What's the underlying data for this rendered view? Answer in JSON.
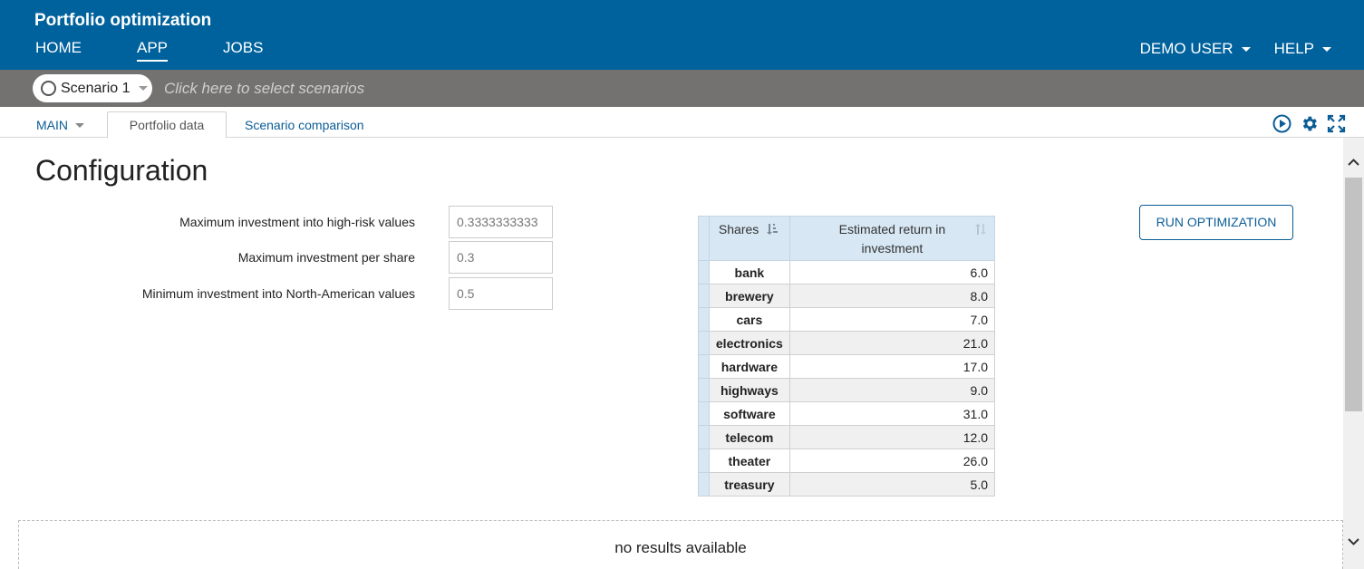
{
  "header": {
    "app_title": "Portfolio optimization",
    "nav": [
      {
        "label": "HOME",
        "active": false
      },
      {
        "label": "APP",
        "active": true
      },
      {
        "label": "JOBS",
        "active": false
      }
    ],
    "user_menu": "DEMO USER",
    "help_menu": "HELP"
  },
  "scenario_bar": {
    "scenario_name": "Scenario 1",
    "placeholder": "Click here to select scenarios"
  },
  "tabs": {
    "main_menu": "MAIN",
    "portfolio": "Portfolio data",
    "comparison": "Scenario comparison",
    "icons": [
      "play-icon",
      "gear-icon",
      "expand-icon"
    ]
  },
  "page": {
    "title": "Configuration",
    "params": [
      {
        "label": "Maximum investment into high-risk values",
        "value": "0.3333333333"
      },
      {
        "label": "Maximum investment per share",
        "value": "0.3"
      },
      {
        "label": "Minimum investment into North-American values",
        "value": "0.5"
      }
    ],
    "run_button": "RUN OPTIMIZATION",
    "table": {
      "col_shares": "Shares",
      "col_return": "Estimated return in investment",
      "rows": [
        {
          "share": "bank",
          "ret": "6.0"
        },
        {
          "share": "brewery",
          "ret": "8.0"
        },
        {
          "share": "cars",
          "ret": "7.0"
        },
        {
          "share": "electronics",
          "ret": "21.0"
        },
        {
          "share": "hardware",
          "ret": "17.0"
        },
        {
          "share": "highways",
          "ret": "9.0"
        },
        {
          "share": "software",
          "ret": "31.0"
        },
        {
          "share": "telecom",
          "ret": "12.0"
        },
        {
          "share": "theater",
          "ret": "26.0"
        },
        {
          "share": "treasury",
          "ret": "5.0"
        }
      ]
    },
    "results_message": "no results available"
  },
  "colors": {
    "header_bg": "#00629d",
    "scenario_bar_bg": "#737270",
    "accent": "#0b5d96",
    "table_header_bg": "#d7e7f3"
  }
}
